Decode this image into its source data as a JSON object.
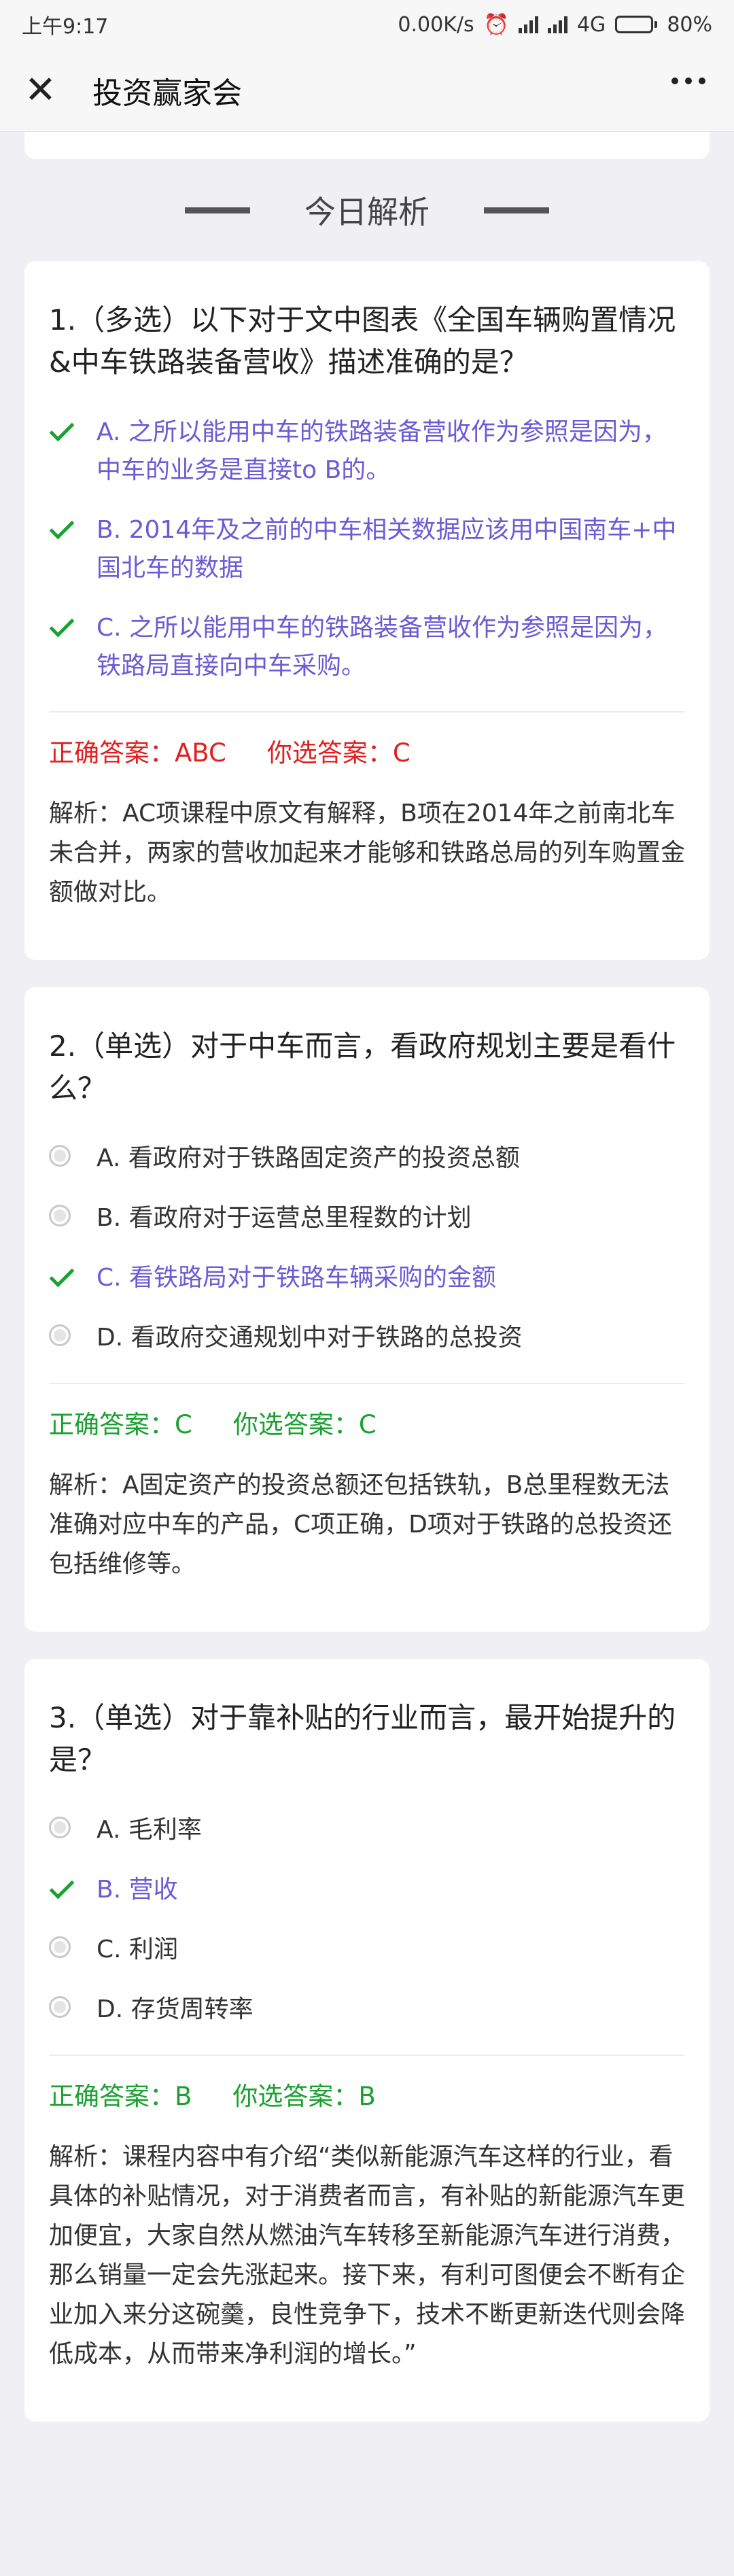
{
  "status": {
    "time": "上午9:17",
    "speed": "0.00K/s",
    "network": "4G",
    "battery": "80%",
    "battery_level": 0.8
  },
  "nav": {
    "title": "投资赢家会"
  },
  "section": {
    "title": "今日解析"
  },
  "questions": [
    {
      "title": "1.（多选）以下对于文中图表《全国车辆购置情况&中车铁路装备营收》描述准确的是？",
      "options": [
        {
          "text": "A. 之所以能用中车的铁路装备营收作为参照是因为，中车的业务是直接to B的。",
          "state": "checked"
        },
        {
          "text": "B. 2014年及之前的中车相关数据应该用中国南车+中国北车的数据",
          "state": "checked"
        },
        {
          "text": "C. 之所以能用中车的铁路装备营收作为参照是因为，铁路局直接向中车采购。",
          "state": "checked"
        }
      ],
      "correct_answer": "正确答案：ABC",
      "your_answer": "你选答案：C",
      "result": "wrong",
      "explanation": "解析：AC项课程中原文有解释，B项在2014年之前南北车未合并，两家的营收加起来才能够和铁路总局的列车购置金额做对比。"
    },
    {
      "title": "2.（单选）对于中车而言，看政府规划主要是看什么？",
      "options": [
        {
          "text": "A. 看政府对于铁路固定资产的投资总额",
          "state": "unchecked"
        },
        {
          "text": "B. 看政府对于运营总里程数的计划",
          "state": "unchecked"
        },
        {
          "text": "C. 看铁路局对于铁路车辆采购的金额",
          "state": "checked"
        },
        {
          "text": "D. 看政府交通规划中对于铁路的总投资",
          "state": "unchecked"
        }
      ],
      "correct_answer": "正确答案：C",
      "your_answer": "你选答案：C",
      "result": "right",
      "explanation": "解析：A固定资产的投资总额还包括铁轨，B总里程数无法准确对应中车的产品，C项正确，D项对于铁路的总投资还包括维修等。"
    },
    {
      "title": "3.（单选）对于靠补贴的行业而言，最开始提升的是？",
      "options": [
        {
          "text": "A. 毛利率",
          "state": "unchecked"
        },
        {
          "text": "B. 营收",
          "state": "checked"
        },
        {
          "text": "C. 利润",
          "state": "unchecked"
        },
        {
          "text": "D. 存货周转率",
          "state": "unchecked"
        }
      ],
      "correct_answer": "正确答案：B",
      "your_answer": "你选答案：B",
      "result": "right",
      "explanation": "解析：课程内容中有介绍“类似新能源汽车这样的行业，看具体的补贴情况，对于消费者而言，有补贴的新能源汽车更加便宜，大家自然从燃油汽车转移至新能源汽车进行消费，那么销量一定会先涨起来。接下来，有利可图便会不断有企业加入来分这碗羹，良性竞争下，技术不断更新迭代则会降低成本，从而带来净利润的增长。”"
    }
  ]
}
